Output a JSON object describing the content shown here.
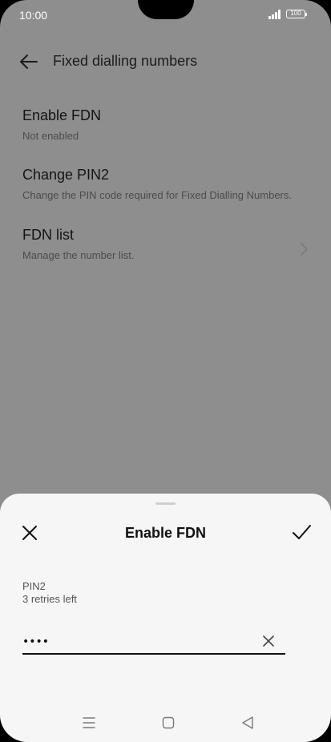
{
  "status_bar": {
    "time": "10:00",
    "battery": "100"
  },
  "header": {
    "title": "Fixed dialling numbers"
  },
  "settings": [
    {
      "title": "Enable FDN",
      "subtitle": "Not enabled"
    },
    {
      "title": "Change PIN2",
      "subtitle": "Change the PIN code required for Fixed Dialling Numbers."
    },
    {
      "title": "FDN list",
      "subtitle": "Manage the number list."
    }
  ],
  "sheet": {
    "title": "Enable FDN",
    "field_label": "PIN2",
    "field_hint": "3 retries left",
    "pin_value": "••••"
  },
  "icons": {
    "back": "back-arrow-icon",
    "chevron": "chevron-right-icon",
    "close": "close-icon",
    "confirm": "checkmark-icon",
    "clear": "clear-icon",
    "nav_menu": "menu-icon",
    "nav_home": "home-icon",
    "nav_back": "back-triangle-icon"
  },
  "colors": {
    "dim_background": "#8e8e8e",
    "sheet_background": "#f6f6f6",
    "text_primary": "#111111"
  }
}
